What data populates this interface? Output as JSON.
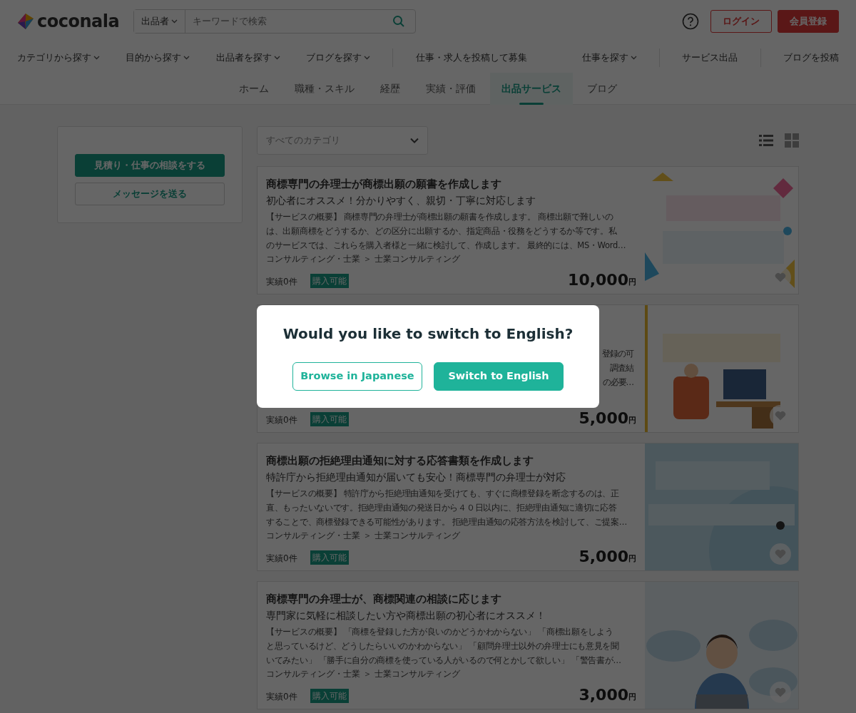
{
  "header": {
    "logo": "coconala",
    "search": {
      "scope": "出品者",
      "placeholder": "キーワードで検索"
    },
    "buttons": [
      {
        "label": "ログイン",
        "kind": "outline"
      },
      {
        "label": "会員登録",
        "kind": "solid"
      }
    ]
  },
  "nav": [
    [
      {
        "label": "カテゴリから探す",
        "dropdown": true
      },
      {
        "label": "目的から探す",
        "dropdown": true
      },
      {
        "label": "出品者を探す",
        "dropdown": true
      },
      {
        "label": "ブログを探す",
        "dropdown": true
      }
    ],
    [
      {
        "label": "仕事・求人を投稿して募集",
        "dropdown": false
      },
      {
        "label": "仕事を探す",
        "dropdown": true
      }
    ],
    [
      {
        "label": "サービス出品",
        "dropdown": false
      }
    ],
    [
      {
        "label": "ブログを投稿",
        "dropdown": false
      }
    ]
  ],
  "subnav": [
    {
      "label": "ホーム",
      "selected": false
    },
    {
      "label": "職種・スキル",
      "selected": false
    },
    {
      "label": "経歴",
      "selected": false
    },
    {
      "label": "実績・評価",
      "selected": false
    },
    {
      "label": "出品サービス",
      "selected": true
    },
    {
      "label": "ブログ",
      "selected": false
    }
  ],
  "sidebar": {
    "buttons": [
      {
        "label": "見積り・仕事の相談をする",
        "kind": "primary"
      },
      {
        "label": "メッセージを送る",
        "kind": "outline"
      }
    ]
  },
  "filter": {
    "category": "すべてのカテゴリ"
  },
  "services": [
    {
      "title": "商標専門の弁理士が商標出願の願書を作成します",
      "subtitle": "初心者にオススメ！分かりやすく、親切・丁寧に対応します",
      "description_lines": [
        "【サービスの概要】 商標専門の弁理士が商標出願の願書を作成します。 商標出願で難しいの",
        "は、出願商標をどうするか、どの区分に出願するか、指定商品・役務をどうするか等です。私",
        "のサービスでは、これらを購入者様と一緒に検討して、作成します。 最終的には、MS・Word…"
      ],
      "category": "コンサルティング・士業 ＞ 士業コンサルティング",
      "record": "実績0件",
      "badge": "購入可能",
      "price": "10,000",
      "currency": "円",
      "kind": "picture"
    },
    {
      "description_lines": [
        "登録の可",
        "調査結",
        "の必要…"
      ],
      "record": "実績0件",
      "badge": "購入可能",
      "price": "5,000",
      "currency": "円",
      "kind": "picture"
    },
    {
      "title": "商標出願の拒絶理由通知に対する応答書類を作成します",
      "subtitle": "特許庁から拒絶理由通知が届いても安心！商標専門の弁理士が対応",
      "description_lines": [
        "【サービスの概要】 特許庁から拒絶理由通知を受けても、すぐに商標登録を断念するのは、正",
        "直、もったいないです。拒絶理由通知の発送日から４０日以内に、拒絶理由通知に適切に応答",
        "することで、商標登録できる可能性があります。 拒絶理由通知の応答方法を検討して、ご提案…"
      ],
      "category": "コンサルティング・士業 ＞ 士業コンサルティング",
      "record": "実績0件",
      "badge": "購入可能",
      "price": "5,000",
      "currency": "円",
      "kind": "picture"
    },
    {
      "title": "商標専門の弁理士が、商標関連の相談に応じます",
      "subtitle": "専門家に気軽に相談したい方や商標出願の初心者にオススメ！",
      "description_lines": [
        "【サービスの概要】 「商標を登録した方が良いのかどうかわからない」 「商標出願をしよう",
        "と思っているけど、どうしたらいいのかわからない」 「顧問弁理士以外の弁理士にも意見を聞",
        "いてみたい」 「勝手に自分の商標を使っている人がいるので何とかして欲しい」 「警告書が…"
      ],
      "category": "コンサルティング・士業 ＞ 士業コンサルティング",
      "record": "実績0件",
      "badge": "購入可能",
      "price": "3,000",
      "currency": "円",
      "kind": "picture"
    }
  ],
  "dialog": {
    "title": "Would you like to switch to English?",
    "buttons": [
      {
        "label": "Browse in Japanese",
        "kind": "outline"
      },
      {
        "label": "Switch to English",
        "kind": "primary"
      }
    ]
  }
}
